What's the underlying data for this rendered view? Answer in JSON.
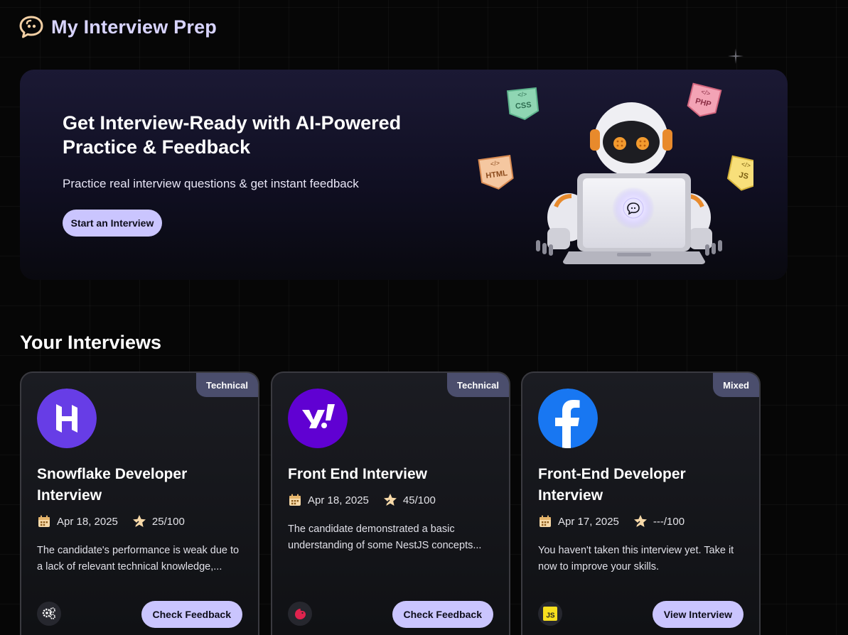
{
  "app": {
    "title": "My Interview Prep",
    "logo_icon": "chat-bubble-icon"
  },
  "hero": {
    "title": "Get Interview-Ready with AI-Powered Practice & Feedback",
    "subtitle": "Practice real interview questions & get instant feedback",
    "cta_label": "Start an Interview",
    "illustration": "robot-laptop-illustration",
    "tag_labels": {
      "css": "CSS",
      "php": "PHP",
      "html": "HTML",
      "js": "JS"
    }
  },
  "section": {
    "title": "Your Interviews"
  },
  "cards": [
    {
      "badge": "Technical",
      "logo_icon": "hostinger-logo-icon",
      "title": "Snowflake Developer Interview",
      "date": "Apr 18, 2025",
      "score": "25/100",
      "description": "The candidate's performance is weak due to a lack of relevant technical knowledge,...",
      "tech_icon": "gear-cluster-icon",
      "button_label": "Check Feedback"
    },
    {
      "badge": "Technical",
      "logo_icon": "yahoo-logo-icon",
      "title": "Front End Interview",
      "date": "Apr 18, 2025",
      "score": "45/100",
      "description": "The candidate demonstrated a basic understanding of some NestJS concepts...",
      "tech_icon": "nestjs-icon",
      "button_label": "Check Feedback"
    },
    {
      "badge": "Mixed",
      "logo_icon": "facebook-logo-icon",
      "title": "Front-End Developer Interview",
      "date": "Apr 17, 2025",
      "score": "---/100",
      "description": "You haven't taken this interview yet. Take it now to improve your skills.",
      "tech_icon": "javascript-icon",
      "button_label": "View Interview"
    }
  ],
  "colors": {
    "accent": "#cac5fe",
    "title": "#d8d4ff",
    "badge": "#4b4e6d",
    "background": "#060606",
    "hostinger": "#673de6",
    "yahoo": "#6001d2",
    "facebook": "#1877f2"
  }
}
